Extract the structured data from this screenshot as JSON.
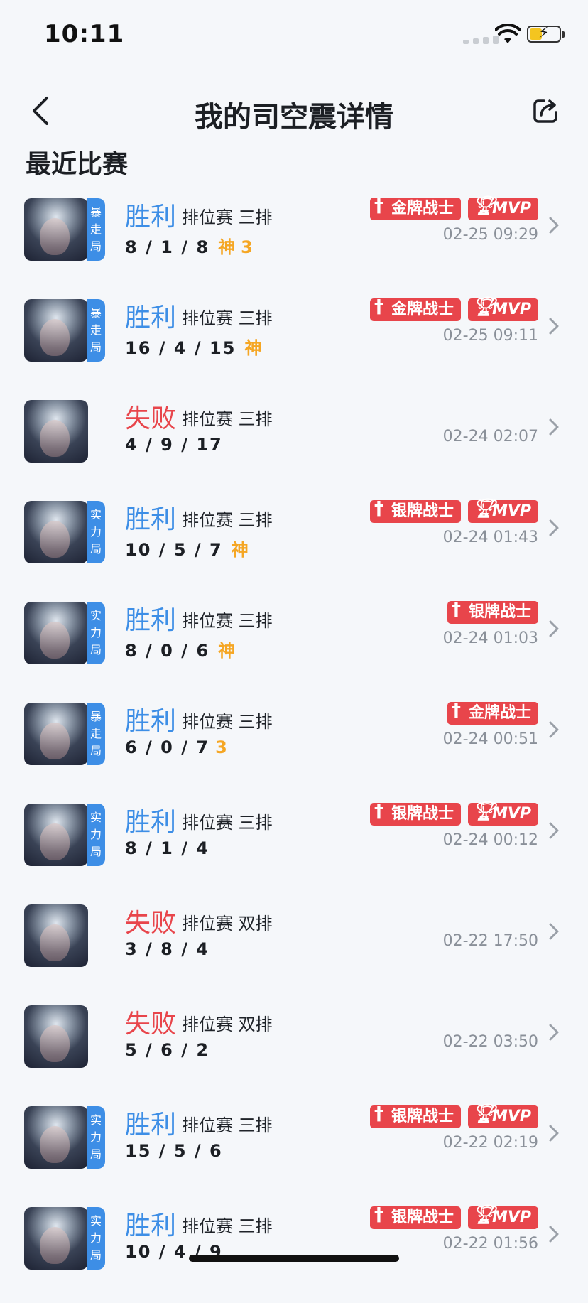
{
  "status": {
    "time": "10:11"
  },
  "nav": {
    "title": "我的司空震详情"
  },
  "section": {
    "title": "最近比赛"
  },
  "matches": [
    {
      "tag": [
        "暴",
        "走",
        "局"
      ],
      "result": "胜利",
      "type": "win",
      "mode": "排位赛 三排",
      "kda": "8 / 1 / 8",
      "god": "神",
      "streak": "3",
      "badges": [
        "金牌战士",
        "MVP"
      ],
      "date": "02-25 09:29"
    },
    {
      "tag": [
        "暴",
        "走",
        "局"
      ],
      "result": "胜利",
      "type": "win",
      "mode": "排位赛 三排",
      "kda": "16 / 4 / 15",
      "god": "神",
      "streak": "",
      "badges": [
        "金牌战士",
        "MVP"
      ],
      "date": "02-25 09:11"
    },
    {
      "tag": [],
      "result": "失败",
      "type": "lose",
      "mode": "排位赛 三排",
      "kda": "4 / 9 / 17",
      "god": "",
      "streak": "",
      "badges": [],
      "date": "02-24 02:07"
    },
    {
      "tag": [
        "实",
        "力",
        "局"
      ],
      "result": "胜利",
      "type": "win",
      "mode": "排位赛 三排",
      "kda": "10 / 5 / 7",
      "god": "神",
      "streak": "",
      "badges": [
        "银牌战士",
        "MVP"
      ],
      "date": "02-24 01:43"
    },
    {
      "tag": [
        "实",
        "力",
        "局"
      ],
      "result": "胜利",
      "type": "win",
      "mode": "排位赛 三排",
      "kda": "8 / 0 / 6",
      "god": "神",
      "streak": "",
      "badges": [
        "银牌战士"
      ],
      "date": "02-24 01:03"
    },
    {
      "tag": [
        "暴",
        "走",
        "局"
      ],
      "result": "胜利",
      "type": "win",
      "mode": "排位赛 三排",
      "kda": "6 / 0 / 7",
      "god": "",
      "streak": "3",
      "badges": [
        "金牌战士"
      ],
      "date": "02-24 00:51"
    },
    {
      "tag": [
        "实",
        "力",
        "局"
      ],
      "result": "胜利",
      "type": "win",
      "mode": "排位赛 三排",
      "kda": "8 / 1 / 4",
      "god": "",
      "streak": "",
      "badges": [
        "银牌战士",
        "MVP"
      ],
      "date": "02-24 00:12"
    },
    {
      "tag": [],
      "result": "失败",
      "type": "lose",
      "mode": "排位赛 双排",
      "kda": "3 / 8 / 4",
      "god": "",
      "streak": "",
      "badges": [],
      "date": "02-22 17:50"
    },
    {
      "tag": [],
      "result": "失败",
      "type": "lose",
      "mode": "排位赛 双排",
      "kda": "5 / 6 / 2",
      "god": "",
      "streak": "",
      "badges": [],
      "date": "02-22 03:50"
    },
    {
      "tag": [
        "实",
        "力",
        "局"
      ],
      "result": "胜利",
      "type": "win",
      "mode": "排位赛 三排",
      "kda": "15 / 5 / 6",
      "god": "",
      "streak": "",
      "badges": [
        "银牌战士",
        "MVP"
      ],
      "date": "02-22 02:19"
    },
    {
      "tag": [
        "实",
        "力",
        "局"
      ],
      "result": "胜利",
      "type": "win",
      "mode": "排位赛 三排",
      "kda": "10 / 4 / 9",
      "god": "",
      "streak": "",
      "badges": [
        "银牌战士",
        "MVP"
      ],
      "date": "02-22 01:56"
    }
  ]
}
